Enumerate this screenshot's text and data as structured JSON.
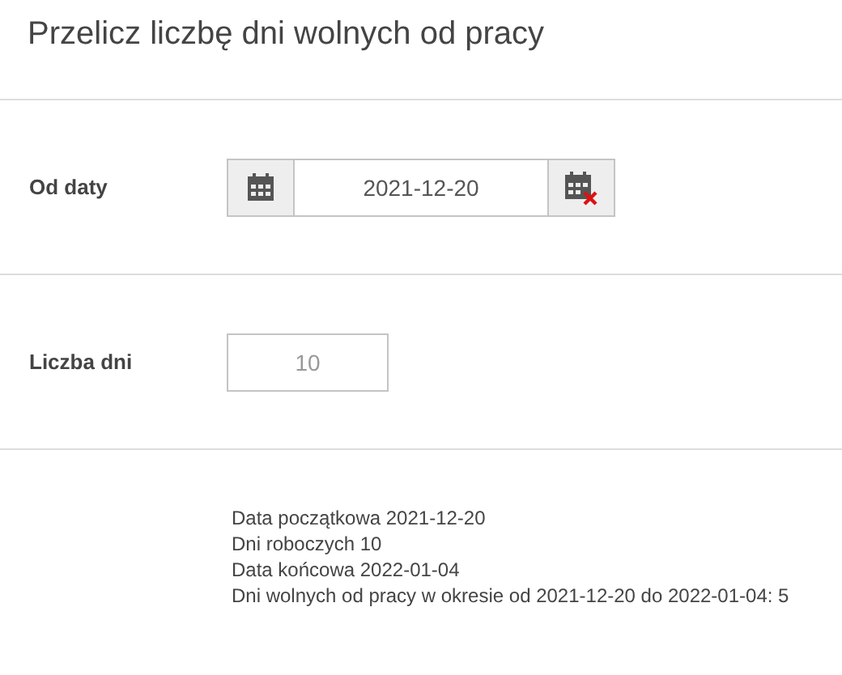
{
  "title": "Przelicz liczbę dni wolnych od pracy",
  "fields": [
    {
      "kind": "date",
      "label": "Od daty",
      "value": "2021-12-20"
    },
    {
      "kind": "number",
      "label": "Liczba dni",
      "value": "10"
    }
  ],
  "results": [
    "Data początkowa 2021-12-20",
    "Dni roboczych 10",
    "Data końcowa 2022-01-04",
    "Dni wolnych od pracy w okresie od 2021-12-20 do 2022-01-04: 5"
  ]
}
